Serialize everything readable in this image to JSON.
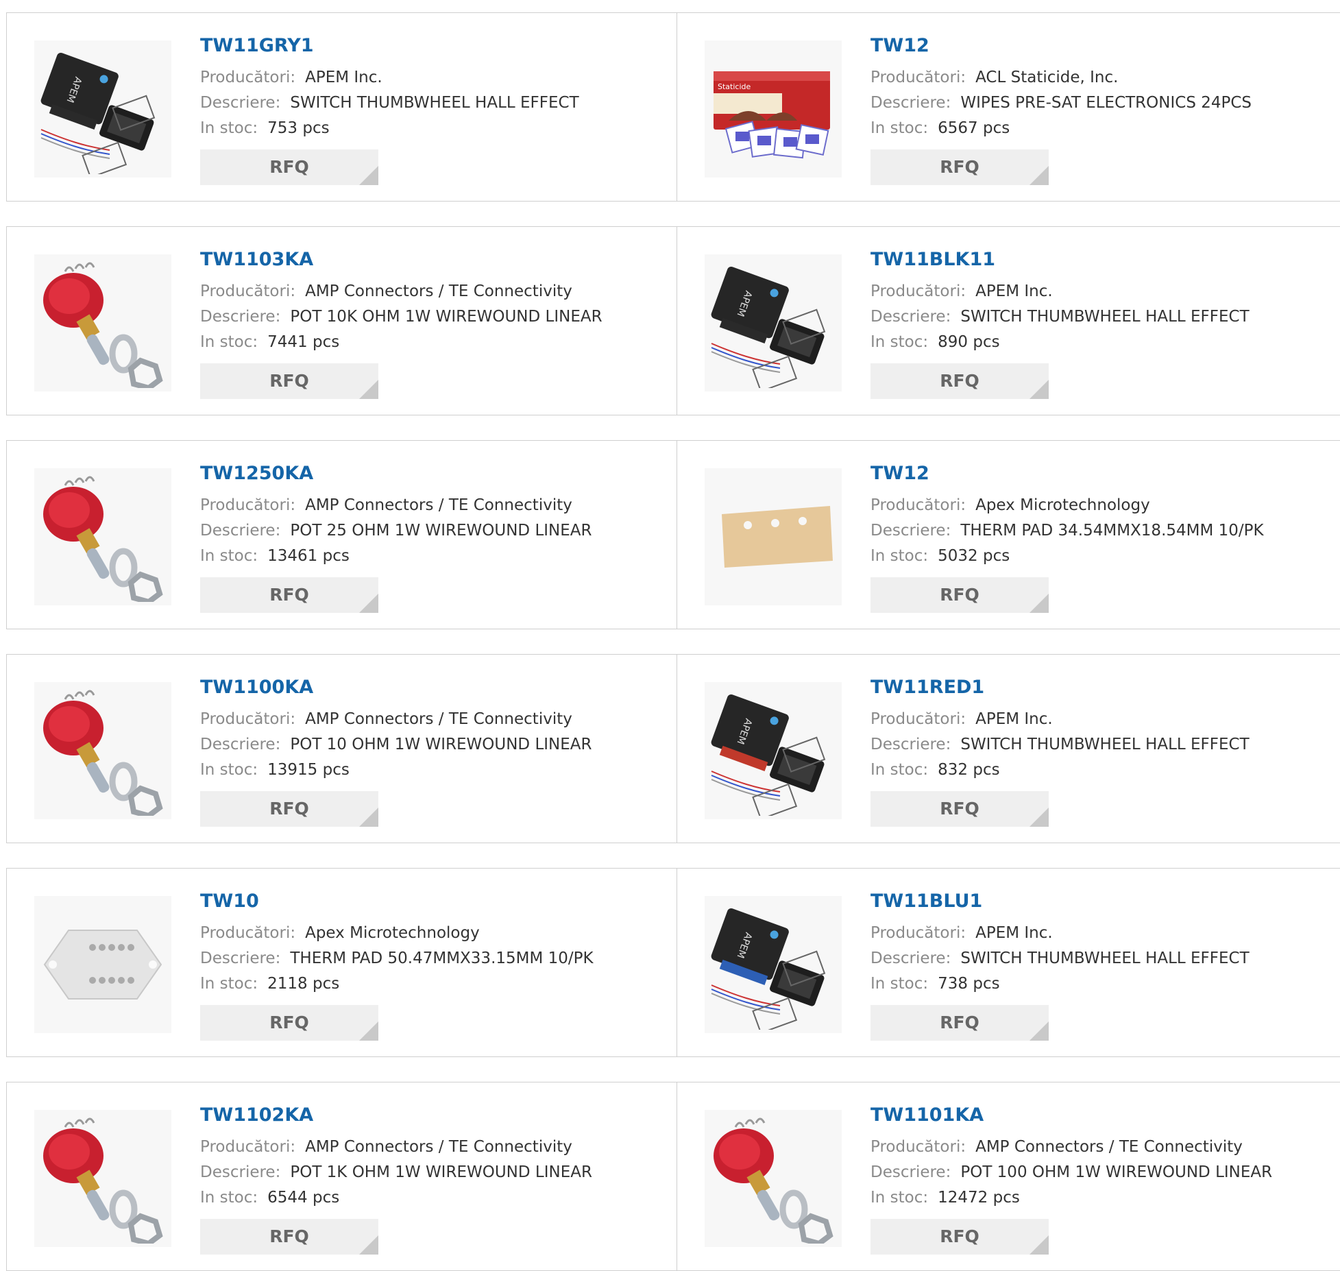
{
  "labels": {
    "manufacturer": "Producători:",
    "description": "Descriere:",
    "stock": "In stoc:",
    "rfq": "RFQ"
  },
  "products": [
    {
      "part": "TW11GRY1",
      "manufacturer": "APEM Inc.",
      "description": "SWITCH THUMBWHEEL HALL EFFECT",
      "stock": "753 pcs",
      "image": "thumbwheel-switch-gray-icon"
    },
    {
      "part": "TW12",
      "manufacturer": "ACL Staticide, Inc.",
      "description": "WIPES PRE-SAT ELECTRONICS 24PCS",
      "stock": "6567 pcs",
      "image": "wipes-box-icon"
    },
    {
      "part": "TW1103KA",
      "manufacturer": "AMP Connectors / TE Connectivity",
      "description": "POT 10K OHM 1W WIREWOUND LINEAR",
      "stock": "7441 pcs",
      "image": "potentiometer-icon"
    },
    {
      "part": "TW11BLK11",
      "manufacturer": "APEM Inc.",
      "description": "SWITCH THUMBWHEEL HALL EFFECT",
      "stock": "890 pcs",
      "image": "thumbwheel-switch-black-icon"
    },
    {
      "part": "TW1250KA",
      "manufacturer": "AMP Connectors / TE Connectivity",
      "description": "POT 25 OHM 1W WIREWOUND LINEAR",
      "stock": "13461 pcs",
      "image": "potentiometer-icon"
    },
    {
      "part": "TW12",
      "manufacturer": "Apex Microtechnology",
      "description": "THERM PAD 34.54MMX18.54MM 10/PK",
      "stock": "5032 pcs",
      "image": "thermal-pad-tan-icon"
    },
    {
      "part": "TW1100KA",
      "manufacturer": "AMP Connectors / TE Connectivity",
      "description": "POT 10 OHM 1W WIREWOUND LINEAR",
      "stock": "13915 pcs",
      "image": "potentiometer-icon"
    },
    {
      "part": "TW11RED1",
      "manufacturer": "APEM Inc.",
      "description": "SWITCH THUMBWHEEL HALL EFFECT",
      "stock": "832 pcs",
      "image": "thumbwheel-switch-red-icon"
    },
    {
      "part": "TW10",
      "manufacturer": "Apex Microtechnology",
      "description": "THERM PAD 50.47MMX33.15MM 10/PK",
      "stock": "2118 pcs",
      "image": "thermal-pad-hex-icon"
    },
    {
      "part": "TW11BLU1",
      "manufacturer": "APEM Inc.",
      "description": "SWITCH THUMBWHEEL HALL EFFECT",
      "stock": "738 pcs",
      "image": "thumbwheel-switch-blue-icon"
    },
    {
      "part": "TW1102KA",
      "manufacturer": "AMP Connectors / TE Connectivity",
      "description": "POT 1K OHM 1W WIREWOUND LINEAR",
      "stock": "6544 pcs",
      "image": "potentiometer-icon"
    },
    {
      "part": "TW1101KA",
      "manufacturer": "AMP Connectors / TE Connectivity",
      "description": "POT 100 OHM 1W WIREWOUND LINEAR",
      "stock": "12472 pcs",
      "image": "potentiometer-icon"
    }
  ]
}
